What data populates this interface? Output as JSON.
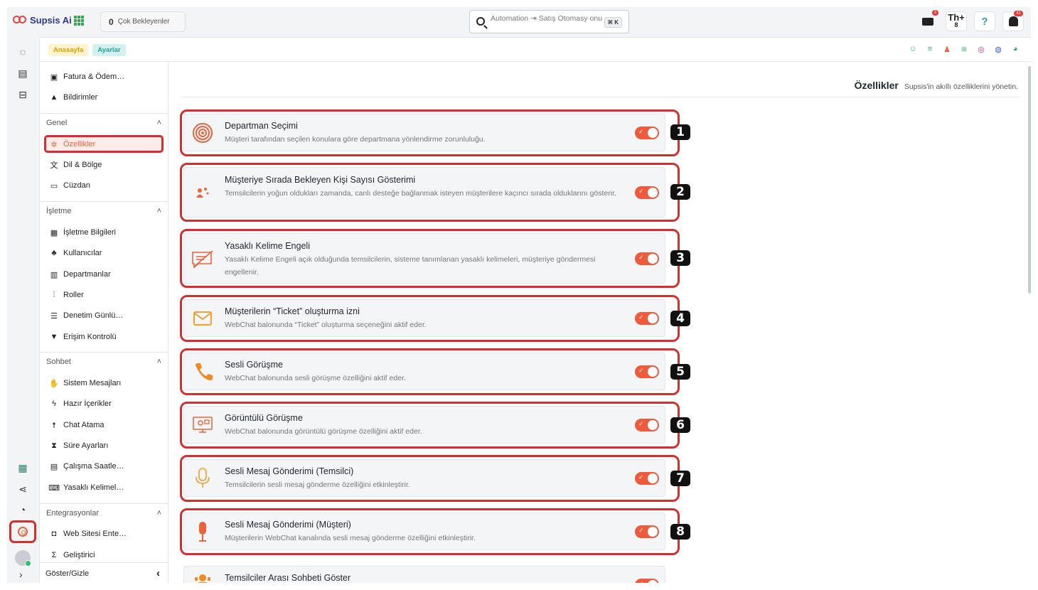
{
  "app": {
    "name": "Supsis Ai"
  },
  "topbar": {
    "pending_count": "0",
    "pending_label": "Çok Bekleyenler",
    "search_placeholder": "Automation ⇥ Satış Otomasy onu",
    "search_shortcut": "⌘ K",
    "mail_badge": "3",
    "th_label": "Th",
    "th_count": "8",
    "help": "?",
    "bell_badge": "41"
  },
  "breadcrumb": {
    "home": "Anasayfa",
    "settings": "Ayarlar"
  },
  "sidebar": {
    "top_items": [
      {
        "label": "Fatura & Ödem…",
        "icon": "invoice-icon"
      },
      {
        "label": "Bildirimler",
        "icon": "bell-icon"
      }
    ],
    "groups": [
      {
        "title": "Genel",
        "items": [
          "Özellikler",
          "Dil & Bölge",
          "Cüzdan"
        ]
      },
      {
        "title": "İşletme",
        "items": [
          "İşletme Bilgileri",
          "Kullanıcılar",
          "Departmanlar",
          "Roller",
          "Denetim Günlü…",
          "Erişim Kontrolü"
        ]
      },
      {
        "title": "Sohbet",
        "items": [
          "Sistem Mesajları",
          "Hazır İçerikler",
          "Chat Atama",
          "Süre Ayarları",
          "Çalışma Saatle…",
          "Yasaklı Kelimel…"
        ]
      },
      {
        "title": "Entegrasyonlar",
        "items": [
          "Web Sitesi Ente…",
          "Geliştirici"
        ]
      }
    ],
    "footer": "Göster/Gizle"
  },
  "main": {
    "title": "Özellikler",
    "subtitle": "Supsis'in akıllı özelliklerini yönetin.",
    "features": [
      {
        "title": "Departman Seçimi",
        "desc": "Müşteri tarafından seçilen konulara göre departmana yönlendirme zorunluluğu.",
        "enabled": true,
        "number": "1"
      },
      {
        "title": "Müşteriye Sırada Bekleyen Kişi Sayısı Gösterimi",
        "desc": "Temsilcilerin yoğun oldukları zamanda, canlı desteğe bağlanmak isteyen müşterilere kaçıncı sırada olduklarını gösterir.",
        "enabled": true,
        "number": "2"
      },
      {
        "title": "Yasaklı Kelime Engeli",
        "desc": "Yasaklı Kelime Engeli açık olduğunda temsilcilerin, sisteme tanımlanan yasaklı kelimeleri, müşteriye göndermesi engellenir.",
        "enabled": true,
        "number": "3"
      },
      {
        "title": "Müşterilerin “Ticket” oluşturma izni",
        "desc": "WebChat balonunda “Ticket” oluşturma seçeneğini aktif eder.",
        "enabled": true,
        "number": "4"
      },
      {
        "title": "Sesli Görüşme",
        "desc": "WebChat balonunda sesli görüşme özelliğini aktif eder.",
        "enabled": true,
        "number": "5"
      },
      {
        "title": "Görüntülü Görüşme",
        "desc": "WebChat balonunda görüntülü görüşme özelliğini aktif eder.",
        "enabled": true,
        "number": "6"
      },
      {
        "title": "Sesli Mesaj Gönderimi (Temsilci)",
        "desc": "Temsilcilerin sesli mesaj gönderme özelliğini etkinleştirir.",
        "enabled": true,
        "number": "7"
      },
      {
        "title": "Sesli Mesaj Gönderimi (Müşteri)",
        "desc": "Müşterilerin WebChat kanalında sesli mesaj gönderme özelliğini etkinleştirir.",
        "enabled": true,
        "number": "8"
      },
      {
        "title": "Temsilciler Arası Sohbeti Göster",
        "desc": "",
        "enabled": true,
        "number": ""
      }
    ]
  },
  "colors": {
    "accent": "#ee5a3b",
    "highlight": "#d32f2f",
    "brand": "#2d3a8c"
  }
}
